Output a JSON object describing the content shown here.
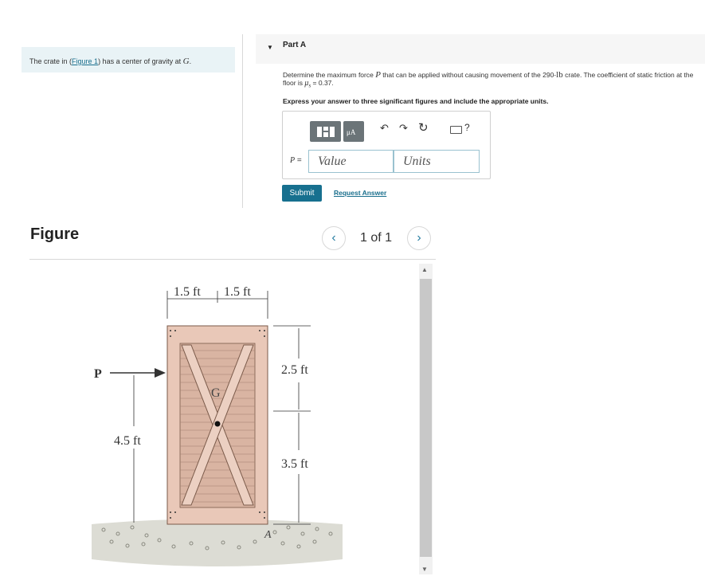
{
  "problem": {
    "prefix": "The crate in (",
    "link": "Figure 1",
    "suffix": ") has a center of gravity at ",
    "var": "G",
    "end": "."
  },
  "part": {
    "title": "Part A",
    "toggle_icon": "triangle-down-icon"
  },
  "question": {
    "t1": "Determine the maximum force ",
    "p": "P",
    "t2": " that can be applied without causing movement of the 290-",
    "unit": "lb",
    "t3": " crate. The coefficient of static friction at the floor is ",
    "mu": "μ",
    "mu_sub": "s",
    "t4": " = 0.37."
  },
  "instruction": "Express your answer to three significant figures and include the appropriate units.",
  "toolbar": {
    "mu_label": "μA",
    "help": "?"
  },
  "answer": {
    "label": "P",
    "equals": " =",
    "value_placeholder": "Value",
    "units_placeholder": "Units"
  },
  "buttons": {
    "submit": "Submit",
    "request": "Request Answer"
  },
  "figure": {
    "title": "Figure",
    "pager": "1 of 1",
    "labels": {
      "dim1": "1.5 ft",
      "dim2": "1.5 ft",
      "dim3": "2.5 ft",
      "dim4": "3.5 ft",
      "dim5": "4.5 ft",
      "p": "P",
      "g": "G",
      "a": "A"
    }
  },
  "colors": {
    "accent": "#17708f",
    "link": "#1a6f8d",
    "crate": "#e9c8b8",
    "crate_dark": "#c79f8f"
  }
}
